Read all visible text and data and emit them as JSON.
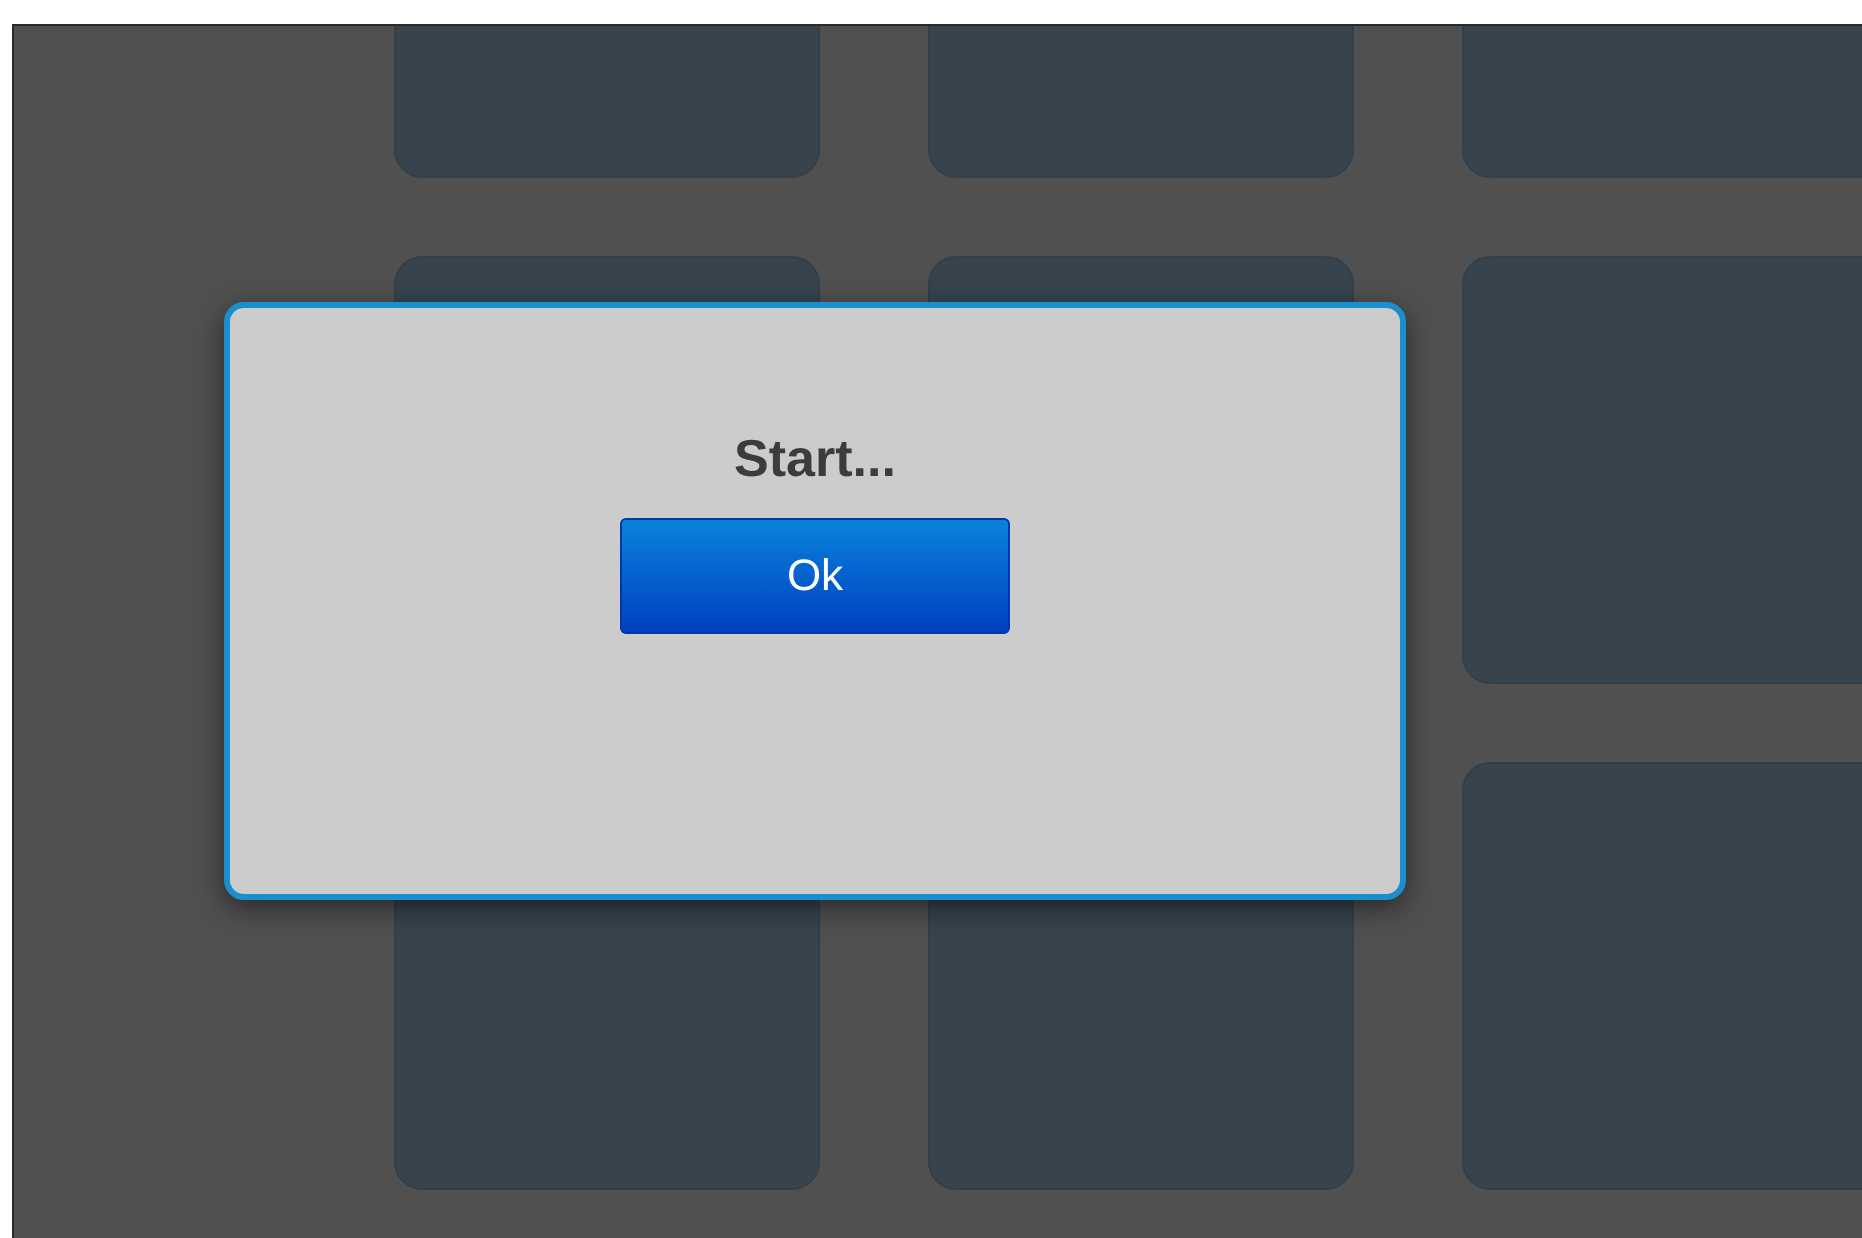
{
  "dialog": {
    "title": "Start...",
    "buttons": [
      "Ok"
    ]
  }
}
